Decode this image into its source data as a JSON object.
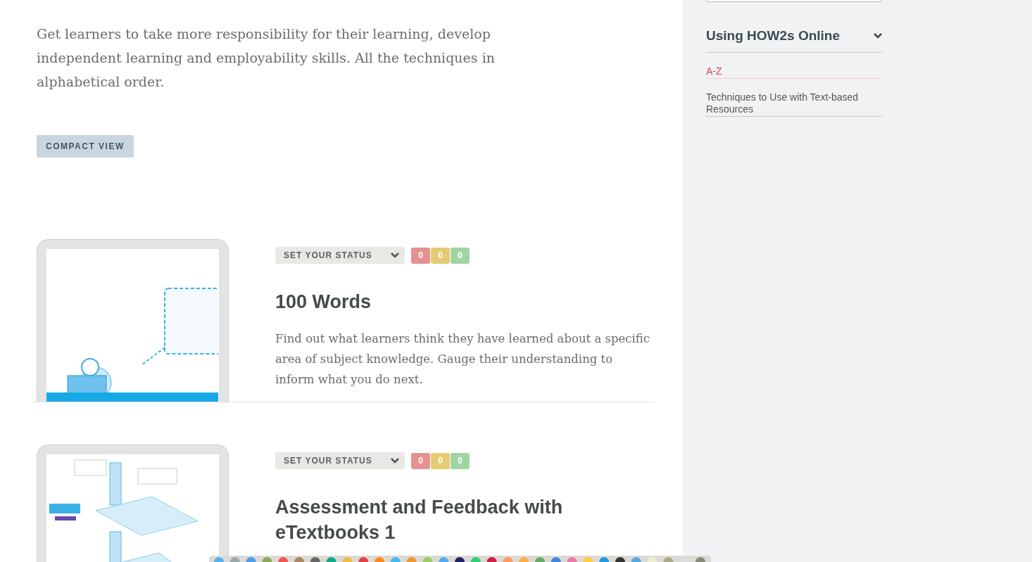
{
  "intro": "Get learners to take more responsibility for their learning, develop independent learning and employability skills. All the techniques in alphabetical order.",
  "view_button": "COMPACT VIEW",
  "techniques": [
    {
      "status_label": "SET YOUR STATUS",
      "counts": [
        {
          "value": "0",
          "color": "#e59191"
        },
        {
          "value": "0",
          "color": "#e5cc73"
        },
        {
          "value": "0",
          "color": "#9fd5a4"
        }
      ],
      "title": "100 Words",
      "description": "Find out what learners think they have learned about a specific area of subject knowledge. Gauge their understanding to inform what you do next.",
      "kind": "chat"
    },
    {
      "status_label": "SET YOUR STATUS",
      "counts": [
        {
          "value": "0",
          "color": "#e59191"
        },
        {
          "value": "0",
          "color": "#e5cc73"
        },
        {
          "value": "0",
          "color": "#9fd5a4"
        }
      ],
      "title": "Assessment and Feedback with eTextbooks 1",
      "kind": "steps"
    }
  ],
  "sidebar": {
    "heading": "Using HOW2s Online",
    "expanded": true,
    "links": [
      {
        "label": "A-Z",
        "selected": true
      },
      {
        "label": "Techniques to Use with Text-based Resources",
        "selected": false
      }
    ]
  }
}
